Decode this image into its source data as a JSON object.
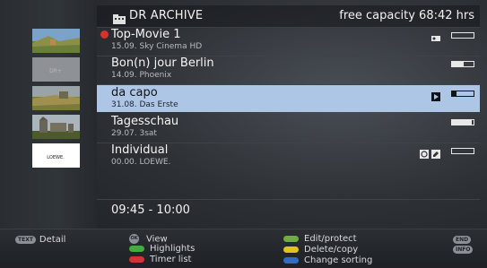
{
  "header": {
    "title": "DR ARCHIVE",
    "capacity": "free capacity 68:42 hrs",
    "folder_icon": "film-folder-icon"
  },
  "recordings": [
    {
      "name": "Top-Movie 1",
      "meta": "15.09.   Sky Cinema HD",
      "progress": 0.0,
      "thumb_icon": "landscape-thumbnail",
      "badges": [
        "key-icon"
      ],
      "recording_dot": true,
      "selected": false
    },
    {
      "name": "Bon(n) jour Berlin",
      "meta": "14.09.   Phoenix",
      "progress": 0.55,
      "thumb_icon": "grey-thumbnail",
      "thumb_text": "DR+",
      "badges": [],
      "recording_dot": false,
      "selected": false
    },
    {
      "name": "da capo",
      "meta": "31.08.   Das Erste",
      "progress": 0.2,
      "thumb_icon": "landscape-thumbnail",
      "badges": [
        "play-icon"
      ],
      "recording_dot": false,
      "selected": true
    },
    {
      "name": "Tagesschau",
      "meta": "29.07.   3sat",
      "progress": 0.9,
      "thumb_icon": "castle-thumbnail",
      "badges": [],
      "recording_dot": false,
      "selected": false
    },
    {
      "name": "Individual",
      "meta": "00.00.   LOEWE.",
      "progress": 0.0,
      "thumb_icon": "loewe-logo-thumbnail",
      "thumb_text": "LOEWE.",
      "badges": [
        "timer-icon",
        "edit-icon"
      ],
      "recording_dot": false,
      "selected": false
    }
  ],
  "time_range": "09:45 - 10:00",
  "footer": {
    "detail": {
      "key": "TEXT",
      "label": "Detail"
    },
    "view": {
      "key": "OK",
      "label": "View"
    },
    "highlights": {
      "label": "Highlights",
      "color": "#3fae3c"
    },
    "timer_list": {
      "label": "Timer list",
      "color": "#d0343a"
    },
    "edit_protect": {
      "label": "Edit/protect",
      "color": "#6fae3c"
    },
    "delete_copy": {
      "label": "Delete/copy",
      "color": "#e3c21d"
    },
    "change_sorting": {
      "label": "Change sorting",
      "color": "#2f6cc8"
    },
    "end_key": "END",
    "info_key": "INFO"
  },
  "colors": {
    "selection": "#aec6e6",
    "background": "#2d3136"
  }
}
